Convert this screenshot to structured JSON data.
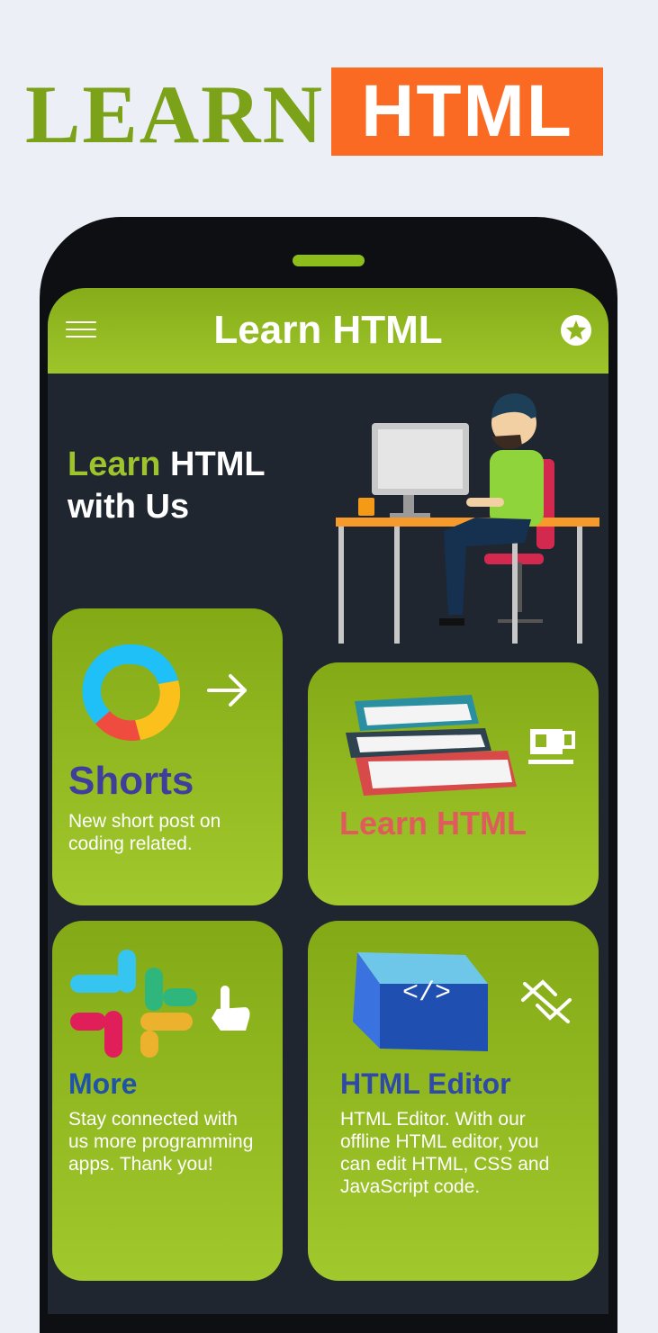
{
  "promo": {
    "learn_word": "LEARN",
    "html_badge": "HTML"
  },
  "colors": {
    "accent_green": "#8cbd1b",
    "promo_orange": "#fb6a22",
    "screen_bg": "#1f2630",
    "shorts_title": "#3d3f9b",
    "learn_title": "#e05b5b",
    "more_title": "#1f53a8",
    "editor_title": "#2e49a8"
  },
  "appbar": {
    "title": "Learn HTML",
    "menu_icon": "hamburger-menu-icon",
    "action_icon": "star-badge-icon"
  },
  "hero": {
    "line1_accent": "Learn",
    "line1_rest": " HTML",
    "line2": "with Us"
  },
  "cards": {
    "shorts": {
      "title": "Shorts",
      "description": "New short post on coding related.",
      "action_icon": "arrow-right-icon"
    },
    "learn": {
      "title": "Learn HTML",
      "action_icon": "coffee-cup-icon"
    },
    "more": {
      "title": "More",
      "description": "Stay connected with us more programming apps. Thank you!",
      "action_icon": "pointing-hand-icon"
    },
    "editor": {
      "title": "HTML Editor",
      "description": "HTML Editor. With our offline HTML editor, you can edit HTML, CSS and JavaScript code.",
      "action_icon": "code-swap-icon"
    }
  }
}
